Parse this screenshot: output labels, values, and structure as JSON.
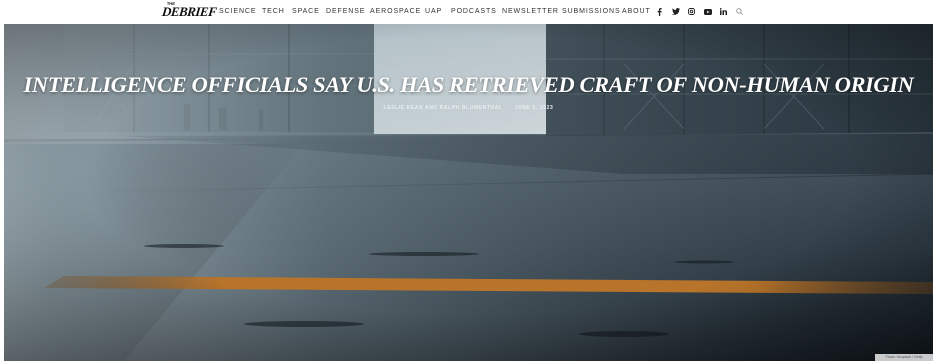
{
  "site": {
    "logo_small": "THE",
    "logo_text": "DEBRIEF"
  },
  "nav": {
    "links": [
      "SCIENCE",
      "TECH",
      "SPACE",
      "DEFENSE",
      "AEROSPACE",
      "UAP",
      "PODCASTS",
      "NEWSLETTER",
      "SUBMISSIONS",
      "ABOUT"
    ],
    "social_icons": [
      "facebook-icon",
      "twitter-icon",
      "instagram-icon",
      "youtube-icon",
      "linkedin-icon",
      "search-icon"
    ]
  },
  "article": {
    "headline": "INTELLIGENCE OFFICIALS SAY U.S. HAS RETRIEVED CRAFT OF NON-HUMAN ORIGIN",
    "authors": "LESLIE KEAN AND RALPH BLUMENTHAL",
    "date": "JUNE 5, 2023",
    "separator": "·",
    "image_credit": "Photo: Unsplash / Getty"
  },
  "colors": {
    "hangar_dark": "#1c2630",
    "floor_stripe": "#b8742a",
    "door_light": "#dfe7ea"
  }
}
